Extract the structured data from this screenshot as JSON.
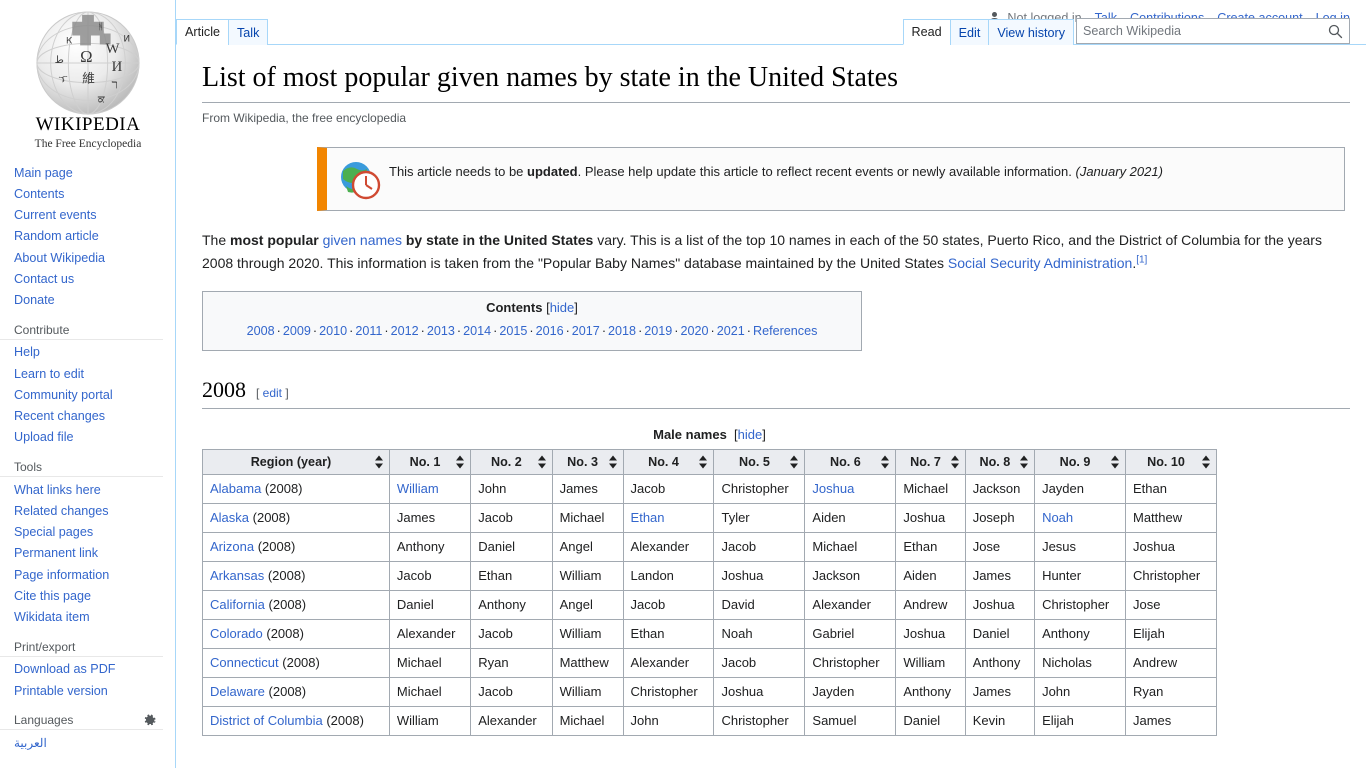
{
  "personal_bar": {
    "not_logged_in": "Not logged in",
    "links": [
      "Talk",
      "Contributions",
      "Create account",
      "Log in"
    ]
  },
  "logo": {
    "wordmark": "WIKIPEDIA",
    "tagline": "The Free Encyclopedia"
  },
  "sidebar": {
    "portals": [
      {
        "heading": "",
        "items": [
          "Main page",
          "Contents",
          "Current events",
          "Random article",
          "About Wikipedia",
          "Contact us",
          "Donate"
        ]
      },
      {
        "heading": "Contribute",
        "items": [
          "Help",
          "Learn to edit",
          "Community portal",
          "Recent changes",
          "Upload file"
        ]
      },
      {
        "heading": "Tools",
        "items": [
          "What links here",
          "Related changes",
          "Special pages",
          "Permanent link",
          "Page information",
          "Cite this page",
          "Wikidata item"
        ]
      },
      {
        "heading": "Print/export",
        "items": [
          "Download as PDF",
          "Printable version"
        ]
      },
      {
        "heading": "Languages",
        "items": [
          "العربية"
        ]
      }
    ]
  },
  "tabs": {
    "namespace": [
      {
        "label": "Article",
        "selected": true
      },
      {
        "label": "Talk",
        "selected": false
      }
    ],
    "views": [
      {
        "label": "Read",
        "selected": true
      },
      {
        "label": "Edit",
        "selected": false
      },
      {
        "label": "View history",
        "selected": false
      }
    ]
  },
  "search": {
    "placeholder": "Search Wikipedia",
    "value": ""
  },
  "article": {
    "title": "List of most popular given names by state in the United States",
    "subtitle": "From Wikipedia, the free encyclopedia",
    "ambox": {
      "text_1": "This article needs to be ",
      "bold": "updated",
      "text_2": ". Please help update this article to reflect recent events or newly available information. ",
      "date": "(January 2021)"
    },
    "lead": {
      "p1": "The ",
      "b1": "most popular ",
      "link1": "given names",
      "b2": " by state in the United States",
      "p2": " vary. This is a list of the top 10 names in each of the 50 states, Puerto Rico, and the District of Columbia for the years 2008 through 2020. This information is taken from the \"Popular Baby Names\" database maintained by the United States ",
      "link2": "Social Security Administration",
      "p3": ".",
      "ref": "[1]"
    },
    "toc": {
      "title": "Contents",
      "hide": "[hide]",
      "items": [
        "2008",
        "2009",
        "2010",
        "2011",
        "2012",
        "2013",
        "2014",
        "2015",
        "2016",
        "2017",
        "2018",
        "2019",
        "2020",
        "2021",
        "References"
      ]
    },
    "section": {
      "heading": "2008",
      "edit": "edit",
      "edit_open": "[",
      "edit_close": "]"
    },
    "table": {
      "caption": "Male names",
      "caption_hide": "[hide]",
      "headers": [
        "Region (year)",
        "No. 1",
        "No. 2",
        "No. 3",
        "No. 4",
        "No. 5",
        "No. 6",
        "No. 7",
        "No. 8",
        "No. 9",
        "No. 10"
      ],
      "rows": [
        {
          "region": "Alabama",
          "year": "(2008)",
          "names": [
            {
              "t": "William",
              "link": true
            },
            {
              "t": "John",
              "link": false
            },
            {
              "t": "James",
              "link": false
            },
            {
              "t": "Jacob",
              "link": false
            },
            {
              "t": "Christopher",
              "link": false
            },
            {
              "t": "Joshua",
              "link": true
            },
            {
              "t": "Michael",
              "link": false
            },
            {
              "t": "Jackson",
              "link": false
            },
            {
              "t": "Jayden",
              "link": false
            },
            {
              "t": "Ethan",
              "link": false
            }
          ]
        },
        {
          "region": "Alaska",
          "year": "(2008)",
          "names": [
            {
              "t": "James",
              "link": false
            },
            {
              "t": "Jacob",
              "link": false
            },
            {
              "t": "Michael",
              "link": false
            },
            {
              "t": "Ethan",
              "link": true
            },
            {
              "t": "Tyler",
              "link": false
            },
            {
              "t": "Aiden",
              "link": false
            },
            {
              "t": "Joshua",
              "link": false
            },
            {
              "t": "Joseph",
              "link": false
            },
            {
              "t": "Noah",
              "link": true
            },
            {
              "t": "Matthew",
              "link": false
            }
          ]
        },
        {
          "region": "Arizona",
          "year": "(2008)",
          "names": [
            {
              "t": "Anthony",
              "link": false
            },
            {
              "t": "Daniel",
              "link": false
            },
            {
              "t": "Angel",
              "link": false
            },
            {
              "t": "Alexander",
              "link": false
            },
            {
              "t": "Jacob",
              "link": false
            },
            {
              "t": "Michael",
              "link": false
            },
            {
              "t": "Ethan",
              "link": false
            },
            {
              "t": "Jose",
              "link": false
            },
            {
              "t": "Jesus",
              "link": false
            },
            {
              "t": "Joshua",
              "link": false
            }
          ]
        },
        {
          "region": "Arkansas",
          "year": "(2008)",
          "names": [
            {
              "t": "Jacob",
              "link": false
            },
            {
              "t": "Ethan",
              "link": false
            },
            {
              "t": "William",
              "link": false
            },
            {
              "t": "Landon",
              "link": false
            },
            {
              "t": "Joshua",
              "link": false
            },
            {
              "t": "Jackson",
              "link": false
            },
            {
              "t": "Aiden",
              "link": false
            },
            {
              "t": "James",
              "link": false
            },
            {
              "t": "Hunter",
              "link": false
            },
            {
              "t": "Christopher",
              "link": false
            }
          ]
        },
        {
          "region": "California",
          "year": "(2008)",
          "names": [
            {
              "t": "Daniel",
              "link": false
            },
            {
              "t": "Anthony",
              "link": false
            },
            {
              "t": "Angel",
              "link": false
            },
            {
              "t": "Jacob",
              "link": false
            },
            {
              "t": "David",
              "link": false
            },
            {
              "t": "Alexander",
              "link": false
            },
            {
              "t": "Andrew",
              "link": false
            },
            {
              "t": "Joshua",
              "link": false
            },
            {
              "t": "Christopher",
              "link": false
            },
            {
              "t": "Jose",
              "link": false
            }
          ]
        },
        {
          "region": "Colorado",
          "year": "(2008)",
          "names": [
            {
              "t": "Alexander",
              "link": false
            },
            {
              "t": "Jacob",
              "link": false
            },
            {
              "t": "William",
              "link": false
            },
            {
              "t": "Ethan",
              "link": false
            },
            {
              "t": "Noah",
              "link": false
            },
            {
              "t": "Gabriel",
              "link": false
            },
            {
              "t": "Joshua",
              "link": false
            },
            {
              "t": "Daniel",
              "link": false
            },
            {
              "t": "Anthony",
              "link": false
            },
            {
              "t": "Elijah",
              "link": false
            }
          ]
        },
        {
          "region": "Connecticut",
          "year": "(2008)",
          "names": [
            {
              "t": "Michael",
              "link": false
            },
            {
              "t": "Ryan",
              "link": false
            },
            {
              "t": "Matthew",
              "link": false
            },
            {
              "t": "Alexander",
              "link": false
            },
            {
              "t": "Jacob",
              "link": false
            },
            {
              "t": "Christopher",
              "link": false
            },
            {
              "t": "William",
              "link": false
            },
            {
              "t": "Anthony",
              "link": false
            },
            {
              "t": "Nicholas",
              "link": false
            },
            {
              "t": "Andrew",
              "link": false
            }
          ]
        },
        {
          "region": "Delaware",
          "year": "(2008)",
          "names": [
            {
              "t": "Michael",
              "link": false
            },
            {
              "t": "Jacob",
              "link": false
            },
            {
              "t": "William",
              "link": false
            },
            {
              "t": "Christopher",
              "link": false
            },
            {
              "t": "Joshua",
              "link": false
            },
            {
              "t": "Jayden",
              "link": false
            },
            {
              "t": "Anthony",
              "link": false
            },
            {
              "t": "James",
              "link": false
            },
            {
              "t": "John",
              "link": false
            },
            {
              "t": "Ryan",
              "link": false
            }
          ]
        },
        {
          "region": "District of Columbia",
          "year": "(2008)",
          "names": [
            {
              "t": "William",
              "link": false
            },
            {
              "t": "Alexander",
              "link": false
            },
            {
              "t": "Michael",
              "link": false
            },
            {
              "t": "John",
              "link": false
            },
            {
              "t": "Christopher",
              "link": false
            },
            {
              "t": "Samuel",
              "link": false
            },
            {
              "t": "Daniel",
              "link": false
            },
            {
              "t": "Kevin",
              "link": false
            },
            {
              "t": "Elijah",
              "link": false
            },
            {
              "t": "James",
              "link": false
            }
          ]
        }
      ]
    }
  },
  "colors": {
    "link": "#3366cc",
    "tab_border": "#a7d7f9",
    "ambox_accent": "#f28500",
    "table_header_bg": "#eaecf0"
  }
}
